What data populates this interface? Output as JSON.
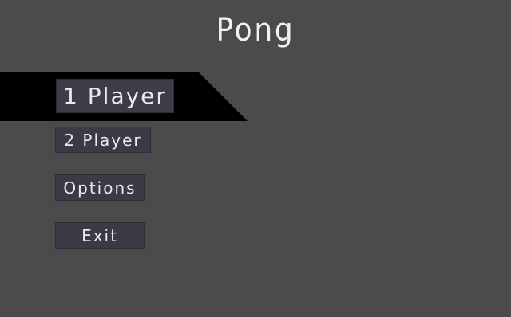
{
  "game": {
    "title": "Pong"
  },
  "menu": {
    "selected_index": 0,
    "items": [
      {
        "label": "1 Player"
      },
      {
        "label": "2 Player"
      },
      {
        "label": "Options"
      },
      {
        "label": "Exit"
      }
    ]
  },
  "colors": {
    "background": "#4b4b4b",
    "highlight": "#000000",
    "button": "#3b3a45",
    "text": "#f2f2f2"
  }
}
